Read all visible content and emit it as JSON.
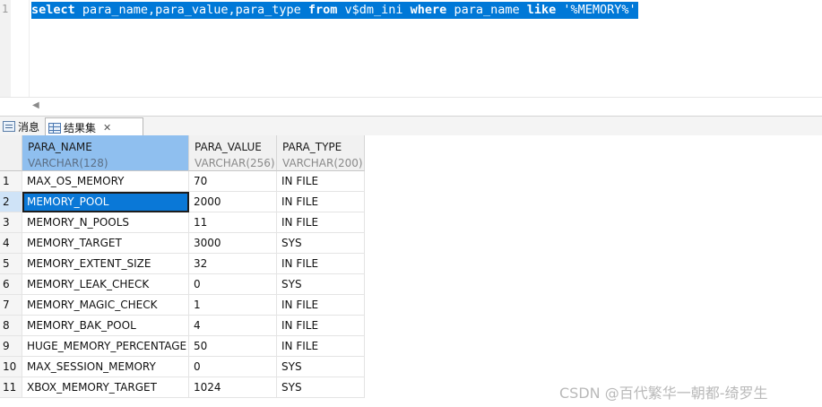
{
  "editor": {
    "line_number": "1",
    "sql_parts": [
      {
        "text": "select",
        "kw": true
      },
      {
        "text": " para_name,para_value,para_type ",
        "kw": false
      },
      {
        "text": "from",
        "kw": true
      },
      {
        "text": " v$dm_ini ",
        "kw": false
      },
      {
        "text": "where",
        "kw": true
      },
      {
        "text": " para_name ",
        "kw": false
      },
      {
        "text": "like",
        "kw": true
      },
      {
        "text": " '%MEMORY%'",
        "kw": false
      }
    ],
    "scroll_left_icon": "triangle-left-icon"
  },
  "tabs": {
    "messages": {
      "label": "消息",
      "icon": "message-icon"
    },
    "results": {
      "label": "结果集",
      "icon": "grid-icon",
      "close": "✕"
    }
  },
  "columns": [
    {
      "name": "PARA_NAME",
      "type": "VARCHAR(128)"
    },
    {
      "name": "PARA_VALUE",
      "type": "VARCHAR(256)"
    },
    {
      "name": "PARA_TYPE",
      "type": "VARCHAR(200)"
    }
  ],
  "rows": [
    {
      "n": "1",
      "name": "MAX_OS_MEMORY",
      "value": "70",
      "type": "IN FILE"
    },
    {
      "n": "2",
      "name": "MEMORY_POOL",
      "value": "2000",
      "type": "IN FILE"
    },
    {
      "n": "3",
      "name": "MEMORY_N_POOLS",
      "value": "11",
      "type": "IN FILE"
    },
    {
      "n": "4",
      "name": "MEMORY_TARGET",
      "value": "3000",
      "type": "SYS"
    },
    {
      "n": "5",
      "name": "MEMORY_EXTENT_SIZE",
      "value": "32",
      "type": "IN FILE"
    },
    {
      "n": "6",
      "name": "MEMORY_LEAK_CHECK",
      "value": "0",
      "type": "SYS"
    },
    {
      "n": "7",
      "name": "MEMORY_MAGIC_CHECK",
      "value": "1",
      "type": "IN FILE"
    },
    {
      "n": "8",
      "name": "MEMORY_BAK_POOL",
      "value": "4",
      "type": "IN FILE"
    },
    {
      "n": "9",
      "name": "HUGE_MEMORY_PERCENTAGE",
      "value": "50",
      "type": "IN FILE"
    },
    {
      "n": "10",
      "name": "MAX_SESSION_MEMORY",
      "value": "0",
      "type": "SYS"
    },
    {
      "n": "11",
      "name": "XBOX_MEMORY_TARGET",
      "value": "1024",
      "type": "SYS"
    }
  ],
  "selected_row": 1,
  "watermark": "CSDN @百代繁华一朝都-绮罗生",
  "colors": {
    "selection": "#0078d7",
    "header_selected": "#8fbfef"
  }
}
